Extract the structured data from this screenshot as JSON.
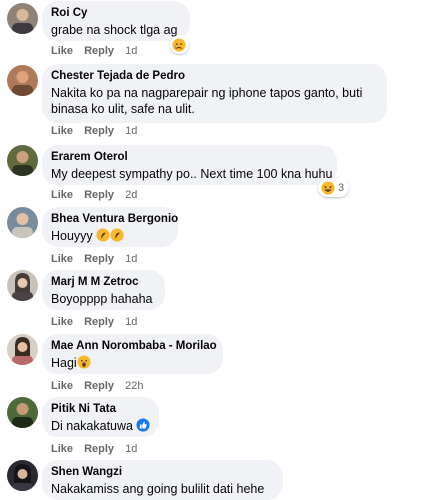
{
  "actions": {
    "like": "Like",
    "reply": "Reply"
  },
  "comments": [
    {
      "author": "Roi Cy",
      "text": "grabe na shock tlga ag",
      "time": "1d",
      "reaction": "sad-emoji",
      "reaction_count": ""
    },
    {
      "author": "Chester Tejada de Pedro",
      "text": "Nakita ko pa na nagparepair ng iphone tapos ganto, buti binasa ko ulit, safe na ulit.",
      "time": "1d"
    },
    {
      "author": "Erarem Oterol",
      "text": "My deepest sympathy po.. Next time 100 kna huhu",
      "time": "2d",
      "reaction": "haha-emoji",
      "reaction_count": "3"
    },
    {
      "author": "Bhea Ventura Bergonio",
      "text": "Houyyy",
      "time": "1d"
    },
    {
      "author": "Marj M M Zetroc",
      "text": "Boyopppp hahaha",
      "time": "1d"
    },
    {
      "author": "Mae Ann Norombaba - Morilao",
      "text": "Hagi",
      "time": "22h"
    },
    {
      "author": "Pitik Ni Tata",
      "text": "Di nakakatuwa",
      "time": "1d"
    },
    {
      "author": "Shen Wangzi",
      "text": "Nakakamiss ang going bulilit dati hehe",
      "time": ""
    }
  ],
  "colors": {
    "bubble": "#f0f2f5",
    "meta": "#65676b",
    "like_blue": "#1877f2",
    "emoji_yellow": "#f7b928"
  }
}
